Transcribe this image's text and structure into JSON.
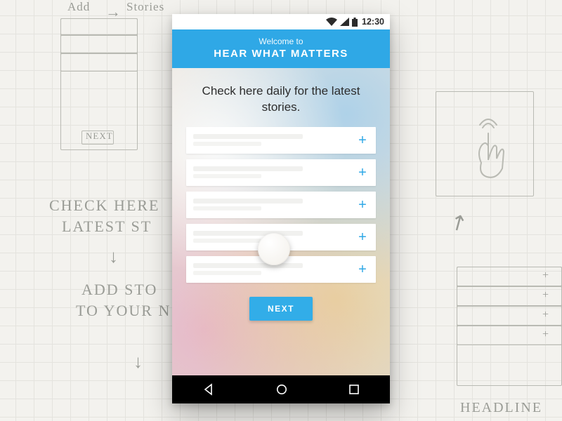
{
  "statusbar": {
    "time": "12:30"
  },
  "header": {
    "subtitle": "Welcome to",
    "title": "HEAR WHAT MATTERS"
  },
  "headline": "Check here daily for the latest stories.",
  "cards": [
    {
      "add_label": "+"
    },
    {
      "add_label": "+"
    },
    {
      "add_label": "+"
    },
    {
      "add_label": "+"
    },
    {
      "add_label": "+"
    }
  ],
  "next_label": "NEXT",
  "colors": {
    "accent": "#2fa8e6"
  },
  "sketch": {
    "top_add": "Add",
    "top_stories": "Stories",
    "next_box": "NEXT",
    "left_check": "CHECK HERE",
    "left_latest": "LATEST ST",
    "left_add": "ADD STO",
    "left_to": "TO YOUR N",
    "right_headline": "HEADLINE"
  }
}
